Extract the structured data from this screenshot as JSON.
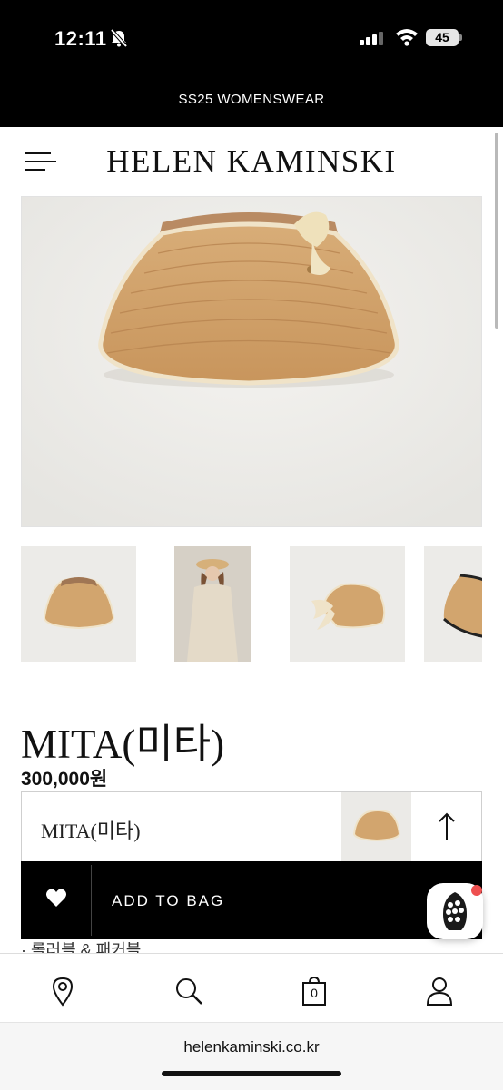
{
  "status_bar": {
    "time": "12:11",
    "battery": "45"
  },
  "promo": {
    "text": "SS25 WOMENSWEAR"
  },
  "header": {
    "logo": "HELEN KAMINSKI"
  },
  "product": {
    "title": "MITA(미타)",
    "price": "300,000원"
  },
  "sticky_bar": {
    "product_name": "MITA(미타)",
    "add_to_bag": "ADD TO BAG"
  },
  "details": {
    "feature_line": "· 롤러블 & 패커블"
  },
  "bottom_nav": {
    "cart_count": "0",
    "icons": [
      "location-icon",
      "search-icon",
      "cart-icon",
      "account-icon"
    ]
  },
  "browser": {
    "url": "helenkaminski.co.kr"
  }
}
